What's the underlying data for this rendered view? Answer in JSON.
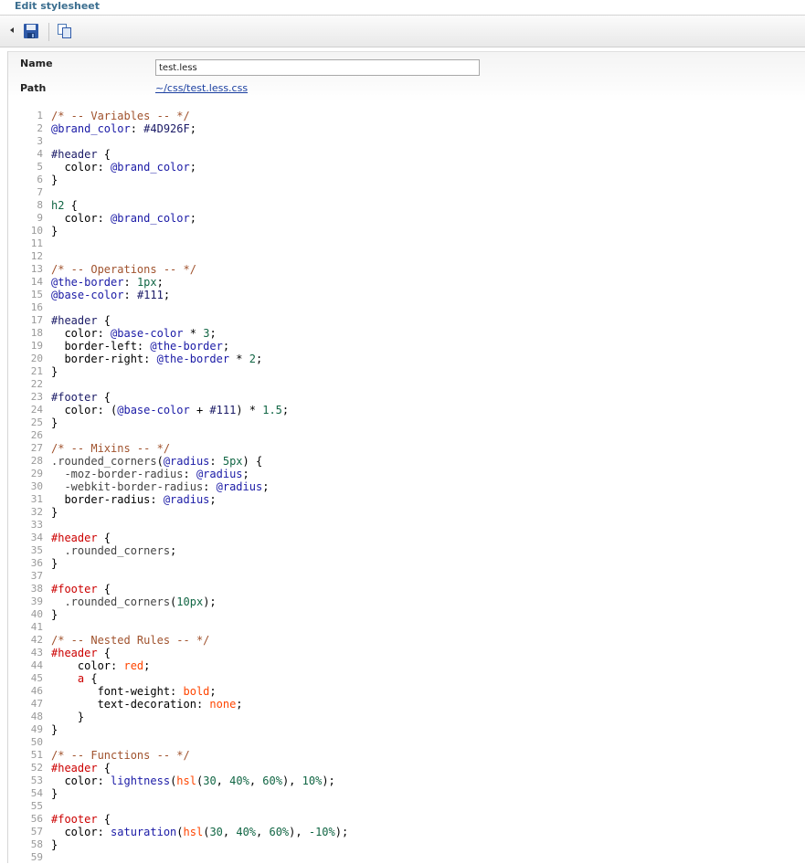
{
  "window": {
    "title": "Edit stylesheet"
  },
  "toolbar": {
    "save_icon": "save-icon",
    "copy_icon": "copy-icon"
  },
  "props": {
    "name_label": "Name",
    "name_value": "test.less",
    "path_label": "Path",
    "path_value": "~/css/test.less.css"
  },
  "code": [
    {
      "n": "1",
      "t": [
        [
          "cm",
          "/* -- Variables -- */"
        ]
      ]
    },
    {
      "n": "2",
      "t": [
        [
          "var",
          "@brand_color"
        ],
        [
          "pl",
          ": "
        ],
        [
          "hex",
          "#4D926F"
        ],
        [
          "pl",
          ";"
        ]
      ]
    },
    {
      "n": "3",
      "t": []
    },
    {
      "n": "4",
      "t": [
        [
          "sel",
          "#header"
        ],
        [
          "pl",
          " {"
        ]
      ]
    },
    {
      "n": "5",
      "t": [
        [
          "pl",
          "  color: "
        ],
        [
          "var",
          "@brand_color"
        ],
        [
          "pl",
          ";"
        ]
      ]
    },
    {
      "n": "6",
      "t": [
        [
          "pl",
          "}"
        ]
      ]
    },
    {
      "n": "7",
      "t": []
    },
    {
      "n": "8",
      "t": [
        [
          "num",
          "h2"
        ],
        [
          "pl",
          " {"
        ]
      ]
    },
    {
      "n": "9",
      "t": [
        [
          "pl",
          "  color: "
        ],
        [
          "var",
          "@brand_color"
        ],
        [
          "pl",
          ";"
        ]
      ]
    },
    {
      "n": "10",
      "t": [
        [
          "pl",
          "}"
        ]
      ]
    },
    {
      "n": "11",
      "t": []
    },
    {
      "n": "12",
      "t": []
    },
    {
      "n": "13",
      "t": [
        [
          "cm",
          "/* -- Operations -- */"
        ]
      ]
    },
    {
      "n": "14",
      "t": [
        [
          "var",
          "@the-border"
        ],
        [
          "pl",
          ": "
        ],
        [
          "num",
          "1px"
        ],
        [
          "pl",
          ";"
        ]
      ]
    },
    {
      "n": "15",
      "t": [
        [
          "var",
          "@base-color"
        ],
        [
          "pl",
          ": "
        ],
        [
          "hex",
          "#111"
        ],
        [
          "pl",
          ";"
        ]
      ]
    },
    {
      "n": "16",
      "t": []
    },
    {
      "n": "17",
      "t": [
        [
          "sel",
          "#header"
        ],
        [
          "pl",
          " {"
        ]
      ]
    },
    {
      "n": "18",
      "t": [
        [
          "pl",
          "  color: "
        ],
        [
          "var",
          "@base-color"
        ],
        [
          "pl",
          " * "
        ],
        [
          "num",
          "3"
        ],
        [
          "pl",
          ";"
        ]
      ]
    },
    {
      "n": "19",
      "t": [
        [
          "pl",
          "  border-left: "
        ],
        [
          "var",
          "@the-border"
        ],
        [
          "pl",
          ";"
        ]
      ]
    },
    {
      "n": "20",
      "t": [
        [
          "pl",
          "  border-right: "
        ],
        [
          "var",
          "@the-border"
        ],
        [
          "pl",
          " * "
        ],
        [
          "num",
          "2"
        ],
        [
          "pl",
          ";"
        ]
      ]
    },
    {
      "n": "21",
      "t": [
        [
          "pl",
          "}"
        ]
      ]
    },
    {
      "n": "22",
      "t": []
    },
    {
      "n": "23",
      "t": [
        [
          "sel",
          "#footer"
        ],
        [
          "pl",
          " {"
        ]
      ]
    },
    {
      "n": "24",
      "t": [
        [
          "pl",
          "  color: ("
        ],
        [
          "var",
          "@base-color"
        ],
        [
          "pl",
          " + "
        ],
        [
          "hex",
          "#111"
        ],
        [
          "pl",
          ") * "
        ],
        [
          "num",
          "1.5"
        ],
        [
          "pl",
          ";"
        ]
      ]
    },
    {
      "n": "25",
      "t": [
        [
          "pl",
          "}"
        ]
      ]
    },
    {
      "n": "26",
      "t": []
    },
    {
      "n": "27",
      "t": [
        [
          "cm",
          "/* -- Mixins -- */"
        ]
      ]
    },
    {
      "n": "28",
      "t": [
        [
          "ovl",
          ".rounded_corners"
        ],
        [
          "pl",
          "("
        ],
        [
          "var",
          "@radius"
        ],
        [
          "pl",
          ": "
        ],
        [
          "num",
          "5px"
        ],
        [
          "pl",
          ") {"
        ]
      ]
    },
    {
      "n": "29",
      "t": [
        [
          "ovl",
          "  -moz-border-radius"
        ],
        [
          "pl",
          ": "
        ],
        [
          "var",
          "@radius"
        ],
        [
          "pl",
          ";"
        ]
      ]
    },
    {
      "n": "30",
      "t": [
        [
          "ovl",
          "  -webkit-border-radius"
        ],
        [
          "pl",
          ": "
        ],
        [
          "var",
          "@radius"
        ],
        [
          "pl",
          ";"
        ]
      ]
    },
    {
      "n": "31",
      "t": [
        [
          "pl",
          "  border-radius: "
        ],
        [
          "var",
          "@radius"
        ],
        [
          "pl",
          ";"
        ]
      ]
    },
    {
      "n": "32",
      "t": [
        [
          "pl",
          "}"
        ]
      ]
    },
    {
      "n": "33",
      "t": []
    },
    {
      "n": "34",
      "t": [
        [
          "hsel",
          "#header"
        ],
        [
          "pl",
          " {"
        ]
      ]
    },
    {
      "n": "35",
      "t": [
        [
          "ovl",
          "  .rounded_corners"
        ],
        [
          "pl",
          ";"
        ]
      ]
    },
    {
      "n": "36",
      "t": [
        [
          "pl",
          "}"
        ]
      ]
    },
    {
      "n": "37",
      "t": []
    },
    {
      "n": "38",
      "t": [
        [
          "hsel",
          "#footer"
        ],
        [
          "pl",
          " {"
        ]
      ]
    },
    {
      "n": "39",
      "t": [
        [
          "ovl",
          "  .rounded_corners"
        ],
        [
          "pl",
          "("
        ],
        [
          "num",
          "10px"
        ],
        [
          "pl",
          ");"
        ]
      ]
    },
    {
      "n": "40",
      "t": [
        [
          "pl",
          "}"
        ]
      ]
    },
    {
      "n": "41",
      "t": []
    },
    {
      "n": "42",
      "t": [
        [
          "cm",
          "/* -- Nested Rules -- */"
        ]
      ]
    },
    {
      "n": "43",
      "t": [
        [
          "hsel",
          "#header"
        ],
        [
          "pl",
          " {"
        ]
      ]
    },
    {
      "n": "44",
      "t": [
        [
          "pl",
          "    color: "
        ],
        [
          "val",
          "red"
        ],
        [
          "pl",
          ";"
        ]
      ]
    },
    {
      "n": "45",
      "t": [
        [
          "hsel",
          "    a"
        ],
        [
          "pl",
          " {"
        ]
      ]
    },
    {
      "n": "46",
      "t": [
        [
          "pl",
          "       font-weight: "
        ],
        [
          "val",
          "bold"
        ],
        [
          "pl",
          ";"
        ]
      ]
    },
    {
      "n": "47",
      "t": [
        [
          "pl",
          "       text-decoration: "
        ],
        [
          "val",
          "none"
        ],
        [
          "pl",
          ";"
        ]
      ]
    },
    {
      "n": "48",
      "t": [
        [
          "pl",
          "    }"
        ]
      ]
    },
    {
      "n": "49",
      "t": [
        [
          "pl",
          "}"
        ]
      ]
    },
    {
      "n": "50",
      "t": []
    },
    {
      "n": "51",
      "t": [
        [
          "cm",
          "/* -- Functions -- */"
        ]
      ]
    },
    {
      "n": "52",
      "t": [
        [
          "hsel",
          "#header"
        ],
        [
          "pl",
          " {"
        ]
      ]
    },
    {
      "n": "53",
      "t": [
        [
          "pl",
          "  color: "
        ],
        [
          "fn",
          "lightness"
        ],
        [
          "pl",
          "("
        ],
        [
          "val",
          "hsl"
        ],
        [
          "pl",
          "("
        ],
        [
          "num",
          "30"
        ],
        [
          "pl",
          ", "
        ],
        [
          "num",
          "40%"
        ],
        [
          "pl",
          ", "
        ],
        [
          "num",
          "60%"
        ],
        [
          "pl",
          "), "
        ],
        [
          "num",
          "10%"
        ],
        [
          "pl",
          ");"
        ]
      ]
    },
    {
      "n": "54",
      "t": [
        [
          "pl",
          "}"
        ]
      ]
    },
    {
      "n": "55",
      "t": []
    },
    {
      "n": "56",
      "t": [
        [
          "hsel",
          "#footer"
        ],
        [
          "pl",
          " {"
        ]
      ]
    },
    {
      "n": "57",
      "t": [
        [
          "pl",
          "  color: "
        ],
        [
          "fn",
          "saturation"
        ],
        [
          "pl",
          "("
        ],
        [
          "val",
          "hsl"
        ],
        [
          "pl",
          "("
        ],
        [
          "num",
          "30"
        ],
        [
          "pl",
          ", "
        ],
        [
          "num",
          "40%"
        ],
        [
          "pl",
          ", "
        ],
        [
          "num",
          "60%"
        ],
        [
          "pl",
          "), "
        ],
        [
          "num",
          "-10%"
        ],
        [
          "pl",
          ");"
        ]
      ]
    },
    {
      "n": "58",
      "t": [
        [
          "pl",
          "}"
        ]
      ]
    },
    {
      "n": "59",
      "t": []
    }
  ]
}
